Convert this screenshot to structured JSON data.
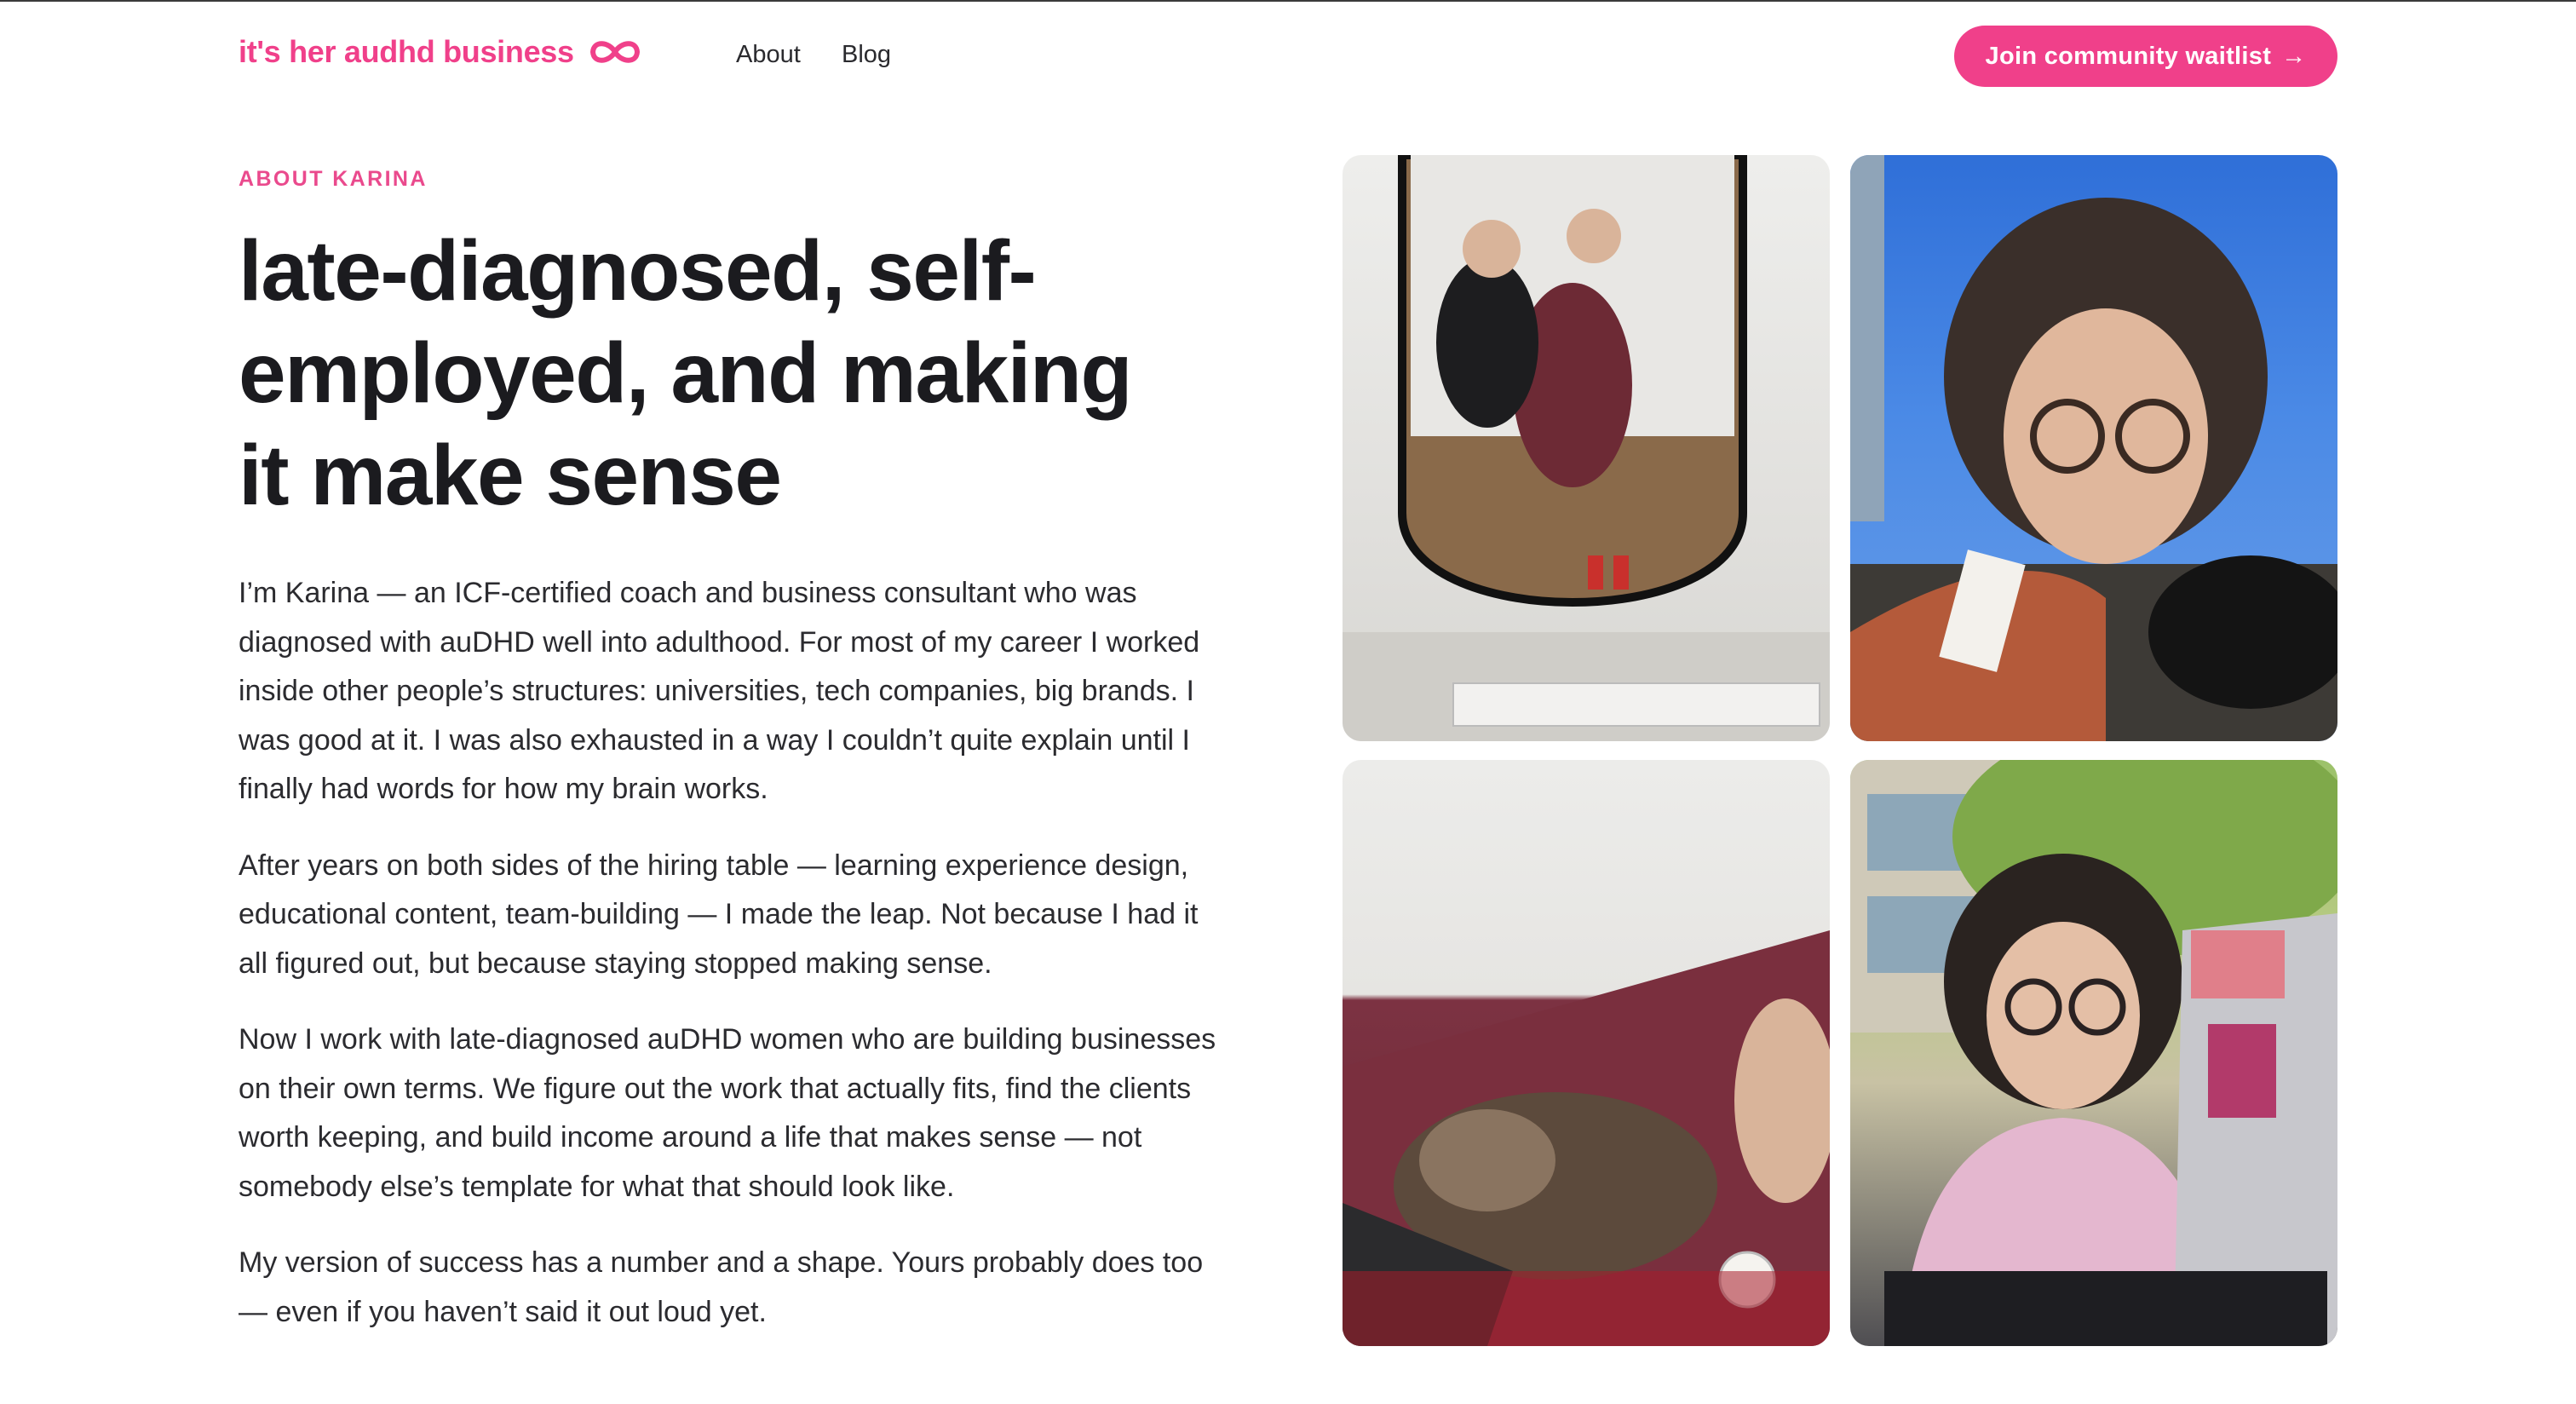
{
  "header": {
    "brand": "it's her audhd business",
    "brand_icon": "infinity-icon",
    "nav": [
      "About",
      "Blog"
    ],
    "cta": "Join community waitlist",
    "cta_icon": "arrow-right-icon",
    "accent_color": "#f0408a"
  },
  "hero": {
    "eyebrow": "ABOUT KARINA",
    "headline_lines": [
      "late-diagnosed, self-",
      "employed, and making",
      "it make sense"
    ]
  },
  "body": {
    "paragraphs": [
      [
        "I’m Karina — an ICF-certified coach and business consultant who was",
        "diagnosed with auDHD well into adulthood. For most of my career I worked",
        "inside other people’s structures: universities, tech companies, big brands. I",
        "was good at it. I was also exhausted in a way I couldn’t quite explain until I",
        "finally had words for how my brain works."
      ],
      [
        "After years on both sides of the hiring table — learning experience design,",
        "educational content, team-building — I made the leap. Not because I had it",
        "all figured out, but because staying stopped making sense."
      ],
      [
        "Now I work with late-diagnosed auDHD women who are building businesses",
        "on their own terms. We figure out the work that actually fits, find the clients",
        "worth keeping, and build income around a life that makes sense — not",
        "somebody else’s template for what that should look like."
      ],
      [
        "My version of success has a number and a shape. Yours probably does too",
        "— even if you haven’t said it out loud yet."
      ]
    ]
  }
}
